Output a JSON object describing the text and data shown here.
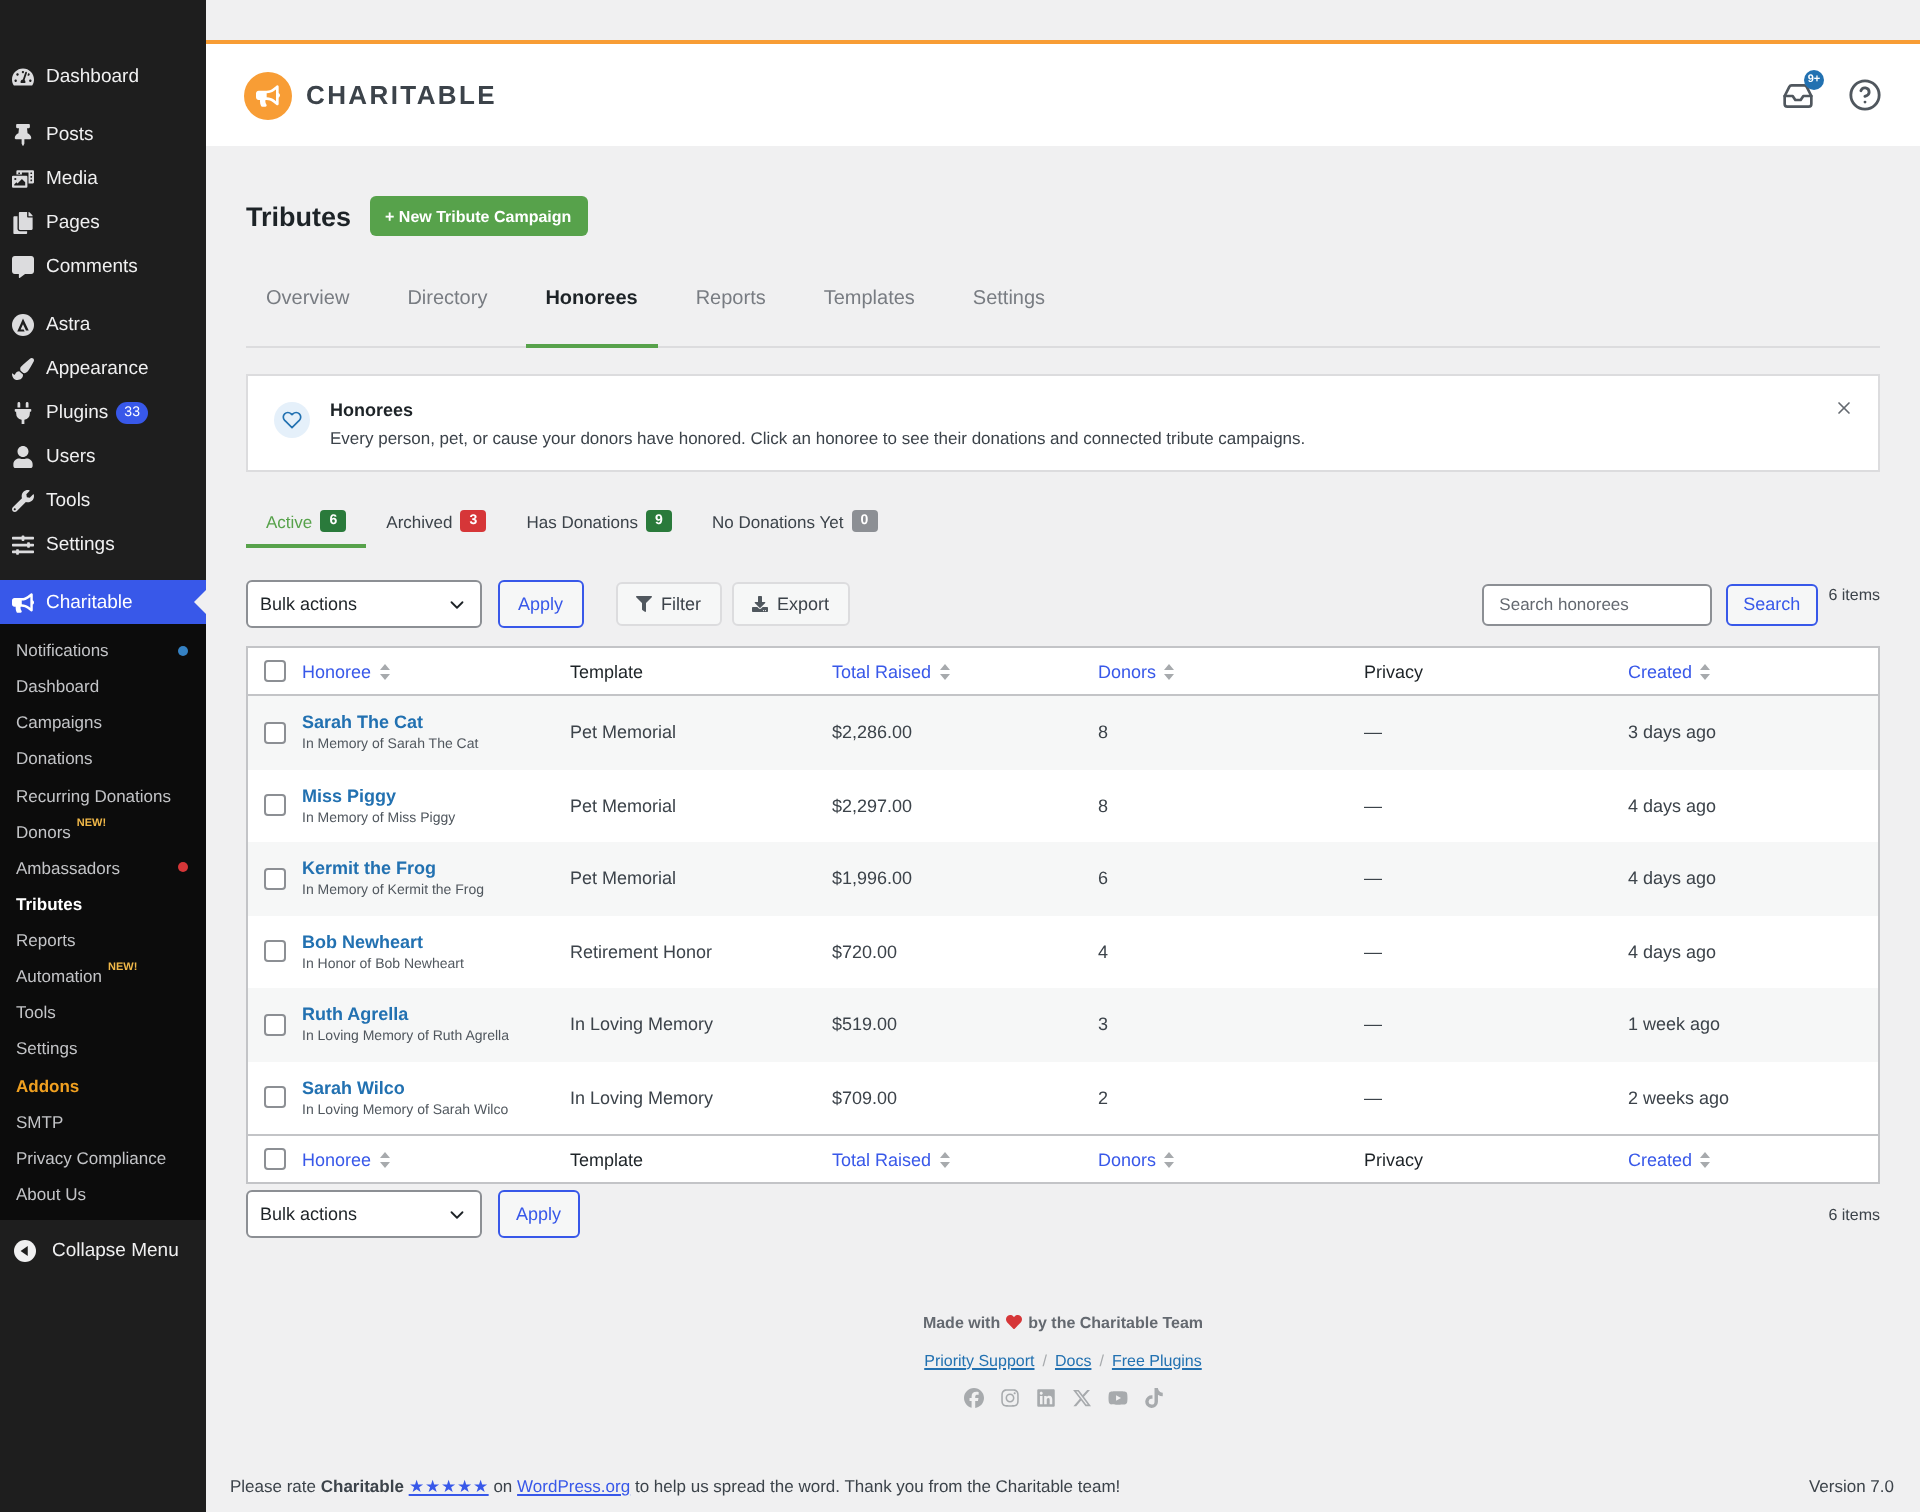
{
  "sidebar": {
    "groups": [
      {
        "items": [
          {
            "label": "Dashboard",
            "selected": false
          }
        ]
      },
      {
        "items": [
          {
            "label": "Posts",
            "selected": false
          },
          {
            "label": "Media",
            "selected": false
          },
          {
            "label": "Pages",
            "selected": false
          },
          {
            "label": "Comments",
            "selected": false
          }
        ]
      },
      {
        "items": [
          {
            "label": "Astra",
            "selected": false
          },
          {
            "label": "Appearance",
            "selected": false
          },
          {
            "label": "Plugins",
            "selected": false,
            "badge": "33"
          },
          {
            "label": "Users",
            "selected": false
          },
          {
            "label": "Tools",
            "selected": false
          },
          {
            "label": "Settings",
            "selected": false
          }
        ]
      },
      {
        "items": [
          {
            "label": "Charitable",
            "selected": true,
            "submenu": [
              {
                "label": "Notifications",
                "kind": "normal",
                "selected": false,
                "color": "#3582c4"
              },
              {
                "label": "Dashboard",
                "kind": "normal",
                "selected": false
              },
              {
                "label": "Campaigns",
                "kind": "normal",
                "selected": false
              },
              {
                "label": "Donations",
                "kind": "normal",
                "selected": false
              },
              {
                "label": "Recurring Donations",
                "kind": "normal",
                "selected": false
              },
              {
                "label": "Donors",
                "kind": "normal",
                "selected": false,
                "tag": "NEW!"
              },
              {
                "label": "Ambassadors",
                "kind": "normal",
                "selected": false,
                "color": "#d63638"
              },
              {
                "label": "Tributes",
                "kind": "normal",
                "selected": true
              },
              {
                "label": "Reports",
                "kind": "normal",
                "selected": false
              },
              {
                "label": "Automation",
                "kind": "normal",
                "selected": false,
                "tag": "NEW!"
              },
              {
                "label": "Tools",
                "kind": "normal",
                "selected": false
              },
              {
                "label": "Settings",
                "kind": "normal",
                "selected": false
              },
              {
                "label": "Addons",
                "kind": "upgrade",
                "selected": false
              },
              {
                "label": "SMTP",
                "kind": "normal",
                "selected": false
              },
              {
                "label": "Privacy Compliance",
                "kind": "normal",
                "selected": false
              },
              {
                "label": "About Us",
                "kind": "normal",
                "selected": false
              }
            ]
          }
        ]
      }
    ],
    "collapse_label": "Collapse Menu"
  },
  "header": {
    "brand": "CHARITABLE",
    "inbox_badge": "9+"
  },
  "page": {
    "title": "Tributes",
    "new_button": "+ New Tribute Campaign"
  },
  "tabs": [
    {
      "label": "Overview",
      "selected": false
    },
    {
      "label": "Directory",
      "selected": false
    },
    {
      "label": "Honorees",
      "selected": true
    },
    {
      "label": "Reports",
      "selected": false
    },
    {
      "label": "Templates",
      "selected": false
    },
    {
      "label": "Settings",
      "selected": false
    }
  ],
  "notice": {
    "title": "Honorees",
    "text": "Every person, pet, or cause your donors have honored. Click an honoree to see their donations and connected tribute campaigns."
  },
  "status_tabs": [
    {
      "label": "Active",
      "count": "6",
      "color": "#2a7a3b",
      "selected": true
    },
    {
      "label": "Archived",
      "count": "3",
      "color": "#d63638",
      "selected": false
    },
    {
      "label": "Has Donations",
      "count": "9",
      "color": "#2a7a3b",
      "selected": false
    },
    {
      "label": "No Donations Yet",
      "count": "0",
      "color": "#8c8f94",
      "selected": false
    }
  ],
  "toolbar": {
    "bulk_select": {
      "value": "Bulk actions"
    },
    "apply": "Apply",
    "filter": "Filter",
    "export": "Export",
    "search_field": {
      "placeholder": "Search honorees"
    },
    "search": "Search",
    "count": "6 items"
  },
  "table": {
    "header_checked": false,
    "columns": [
      {
        "label": "Honoree",
        "sortable": true
      },
      {
        "label": "Template",
        "sortable": false
      },
      {
        "label": "Total Raised",
        "sortable": true
      },
      {
        "label": "Donors",
        "sortable": true
      },
      {
        "label": "Privacy",
        "sortable": false
      },
      {
        "label": "Created",
        "sortable": true
      }
    ],
    "rows": [
      {
        "checked": false,
        "name": "Sarah The Cat",
        "subtitle": "In Memory of Sarah The Cat",
        "template": "Pet Memorial",
        "total_raised": "$2,286.00",
        "donors": "8",
        "privacy": "—",
        "created": "3 days ago"
      },
      {
        "checked": false,
        "name": "Miss Piggy",
        "subtitle": "In Memory of Miss Piggy",
        "template": "Pet Memorial",
        "total_raised": "$2,297.00",
        "donors": "8",
        "privacy": "—",
        "created": "4 days ago"
      },
      {
        "checked": false,
        "name": "Kermit the Frog",
        "subtitle": "In Memory of Kermit the Frog",
        "template": "Pet Memorial",
        "total_raised": "$1,996.00",
        "donors": "6",
        "privacy": "—",
        "created": "4 days ago"
      },
      {
        "checked": false,
        "name": "Bob Newheart",
        "subtitle": "In Honor of Bob Newheart",
        "template": "Retirement Honor",
        "total_raised": "$720.00",
        "donors": "4",
        "privacy": "—",
        "created": "4 days ago"
      },
      {
        "checked": false,
        "name": "Ruth Agrella",
        "subtitle": "In Loving Memory of Ruth Agrella",
        "template": "In Loving Memory",
        "total_raised": "$519.00",
        "donors": "3",
        "privacy": "—",
        "created": "1 week ago"
      },
      {
        "checked": false,
        "name": "Sarah Wilco",
        "subtitle": "In Loving Memory of Sarah Wilco",
        "template": "In Loving Memory",
        "total_raised": "$709.00",
        "donors": "2",
        "privacy": "—",
        "created": "2 weeks ago"
      }
    ],
    "footer_checked": false,
    "footer_columns": [
      {
        "label": "Honoree",
        "sortable": true
      },
      {
        "label": "Template",
        "sortable": false
      },
      {
        "label": "Total Raised",
        "sortable": true
      },
      {
        "label": "Donors",
        "sortable": true
      },
      {
        "label": "Privacy",
        "sortable": false
      },
      {
        "label": "Created",
        "sortable": true
      }
    ]
  },
  "bottom_toolbar": {
    "bulk_select": {
      "value": "Bulk actions"
    },
    "apply": "Apply",
    "count": "6 items"
  },
  "footer": {
    "made_with": {
      "before": "Made with",
      "after": "by the Charitable Team"
    },
    "links": [
      "Priority Support",
      "Docs",
      "Free Plugins"
    ],
    "separators": [
      "/",
      "/"
    ]
  },
  "rating": {
    "before": "Please rate **Charitable**",
    "stars_link": "★★★★★",
    "middle": "on",
    "site_link": "WordPress.org",
    "after": "to help us spread the word. Thank you from the Charitable team!"
  },
  "version": "Version 7.0"
}
